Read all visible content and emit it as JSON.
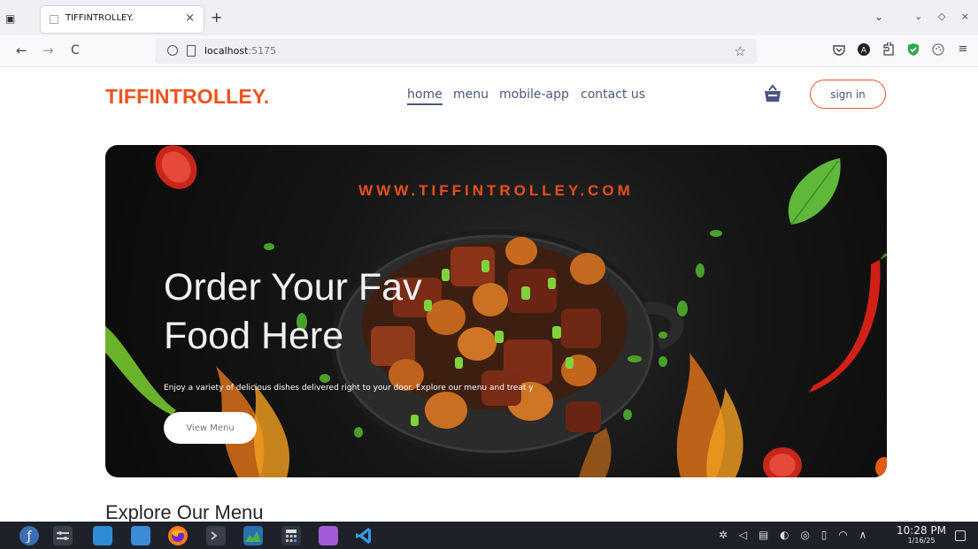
{
  "browser": {
    "tab_title": "TIFFINTROLLEY.",
    "tab_close": "×",
    "new_tab": "+",
    "tab_overflow": "⌄",
    "window_controls": [
      "⌄",
      "◇",
      "×"
    ],
    "url_host": "localhost",
    "url_port": ":5175",
    "back": "←",
    "forward": "→",
    "reload": "C",
    "bookmark_star": "☆"
  },
  "site": {
    "logo": "TIFFINTROLLEY.",
    "menu": [
      {
        "label": "home",
        "active": true
      },
      {
        "label": "menu",
        "active": false
      },
      {
        "label": "mobile-app",
        "active": false
      },
      {
        "label": "contact us",
        "active": false
      }
    ],
    "signin_label": "sign in",
    "accent": "#f0521f",
    "nav_color": "#49557e"
  },
  "hero": {
    "site_url": "WWW.TIFFINTROLLEY.COM",
    "title_line1": "Order Your Fav",
    "title_line2": "Food Here",
    "description": "Enjoy a variety of delicious dishes delivered right to your door. Explore our menu and treat y",
    "button_label": "View Menu"
  },
  "section": {
    "explore_title": "Explore Our Menu"
  },
  "taskbar": {
    "time": "10:28 PM",
    "date": "1/16/25"
  }
}
